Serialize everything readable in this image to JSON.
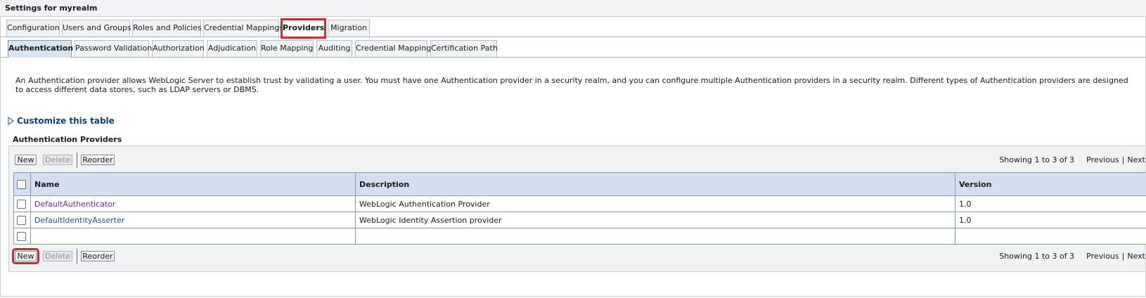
{
  "title": "Settings for myrealm",
  "tabs": [
    {
      "label": "Configuration",
      "active": false
    },
    {
      "label": "Users and Groups",
      "active": false
    },
    {
      "label": "Roles and Policies",
      "active": false
    },
    {
      "label": "Credential Mappings",
      "active": false
    },
    {
      "label": "Providers",
      "active": true
    },
    {
      "label": "Migration",
      "active": false
    }
  ],
  "subtabs": [
    {
      "label": "Authentication",
      "active": true
    },
    {
      "label": "Password Validation",
      "active": false
    },
    {
      "label": "Authorization",
      "active": false
    },
    {
      "label": "Adjudication",
      "active": false
    },
    {
      "label": "Role Mapping",
      "active": false
    },
    {
      "label": "Auditing",
      "active": false
    },
    {
      "label": "Credential Mapping",
      "active": false
    },
    {
      "label": "Certification Path",
      "active": false
    }
  ],
  "intro_text": "An Authentication provider allows WebLogic Server to establish trust by validating a user. You must have one Authentication provider in a security realm, and you can configure multiple Authentication providers in a security realm. Different types of Authentication providers are designed to access different data stores, such as LDAP servers or DBMS.",
  "customize_link": "Customize this table",
  "section_title": "Authentication Providers",
  "toolbar": {
    "new_label": "New",
    "delete_label": "Delete",
    "reorder_label": "Reorder",
    "showing": "Showing 1 to 3 of 3",
    "previous": "Previous",
    "next": "Next"
  },
  "table": {
    "columns": [
      "Name",
      "Description",
      "Version"
    ],
    "rows": [
      {
        "name": "DefaultAuthenticator",
        "description": "WebLogic Authentication Provider",
        "version": "1.0"
      },
      {
        "name": "DefaultIdentityAsserter",
        "description": "WebLogic Identity Assertion provider",
        "version": "1.0"
      },
      {
        "name": "",
        "description": "",
        "version": ""
      }
    ]
  },
  "colors": {
    "highlight": "#d9232d",
    "header_bg": "#d3dfee",
    "link": "#1f4f9b",
    "visited_link": "#6c2c8c",
    "customize_link": "#0e3f79"
  }
}
